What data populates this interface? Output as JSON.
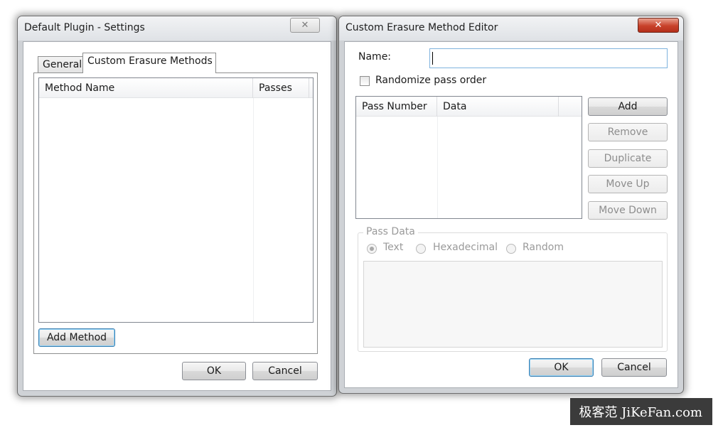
{
  "settings_window": {
    "title": "Default Plugin - Settings",
    "close_glyph": "✕",
    "tabs": [
      {
        "label": "General"
      },
      {
        "label": "Custom Erasure Methods"
      }
    ],
    "list_columns": [
      "Method Name",
      "Passes"
    ],
    "add_method_label": "Add Method",
    "ok_label": "OK",
    "cancel_label": "Cancel"
  },
  "editor_window": {
    "title": "Custom Erasure Method Editor",
    "close_glyph": "✕",
    "name_label": "Name:",
    "name_value": "",
    "randomize_label": "Randomize pass order",
    "pass_columns": [
      "Pass Number",
      "Data"
    ],
    "buttons": {
      "add": "Add",
      "remove": "Remove",
      "duplicate": "Duplicate",
      "move_up": "Move Up",
      "move_down": "Move Down"
    },
    "pass_data": {
      "group_label": "Pass Data",
      "options": [
        "Text",
        "Hexadecimal",
        "Random"
      ],
      "selected": "Text"
    },
    "ok_label": "OK",
    "cancel_label": "Cancel"
  },
  "watermark": "极客范 JiKeFan.com",
  "colors": {
    "close_active": "#c8412a",
    "default_button_border": "#3c7fb1",
    "disabled_text": "#8d8d8d"
  }
}
